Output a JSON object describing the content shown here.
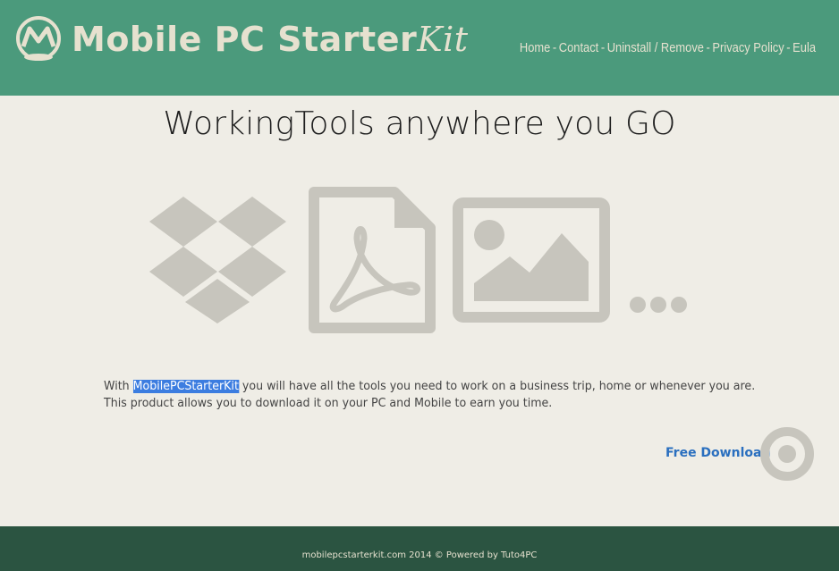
{
  "header": {
    "logo_text_main": "Mobile PC Starter",
    "logo_text_kit": "Kit",
    "nav": [
      {
        "label": "Home"
      },
      {
        "label": "Contact"
      },
      {
        "label": "Uninstall / Remove"
      },
      {
        "label": "Privacy Policy"
      },
      {
        "label": "Eula"
      }
    ],
    "nav_separator": "-"
  },
  "main": {
    "headline": "WorkingTools anywhere you GO",
    "icons": [
      "dropbox-icon",
      "pdf-file-icon",
      "image-icon",
      "more-dots-icon"
    ],
    "desc_prefix": "With ",
    "desc_highlight": "MobilePCStarterKit",
    "desc_line1_rest": " you will have all the tools you need to work on a business trip, home or whenever you are.",
    "desc_line2": "This product allows you to download it on your PC and Mobile to earn you time.",
    "download_label": "Free Download"
  },
  "footer": {
    "text": "mobilepcstarterkit.com 2014 © Powered by Tuto4PC"
  },
  "colors": {
    "header_bg": "#4b9a7c",
    "footer_bg": "#2b5441",
    "page_bg": "#efede6",
    "icon_gray": "#c7c5bd",
    "link_blue": "#2a6fbf",
    "highlight": "#3c7de0"
  }
}
